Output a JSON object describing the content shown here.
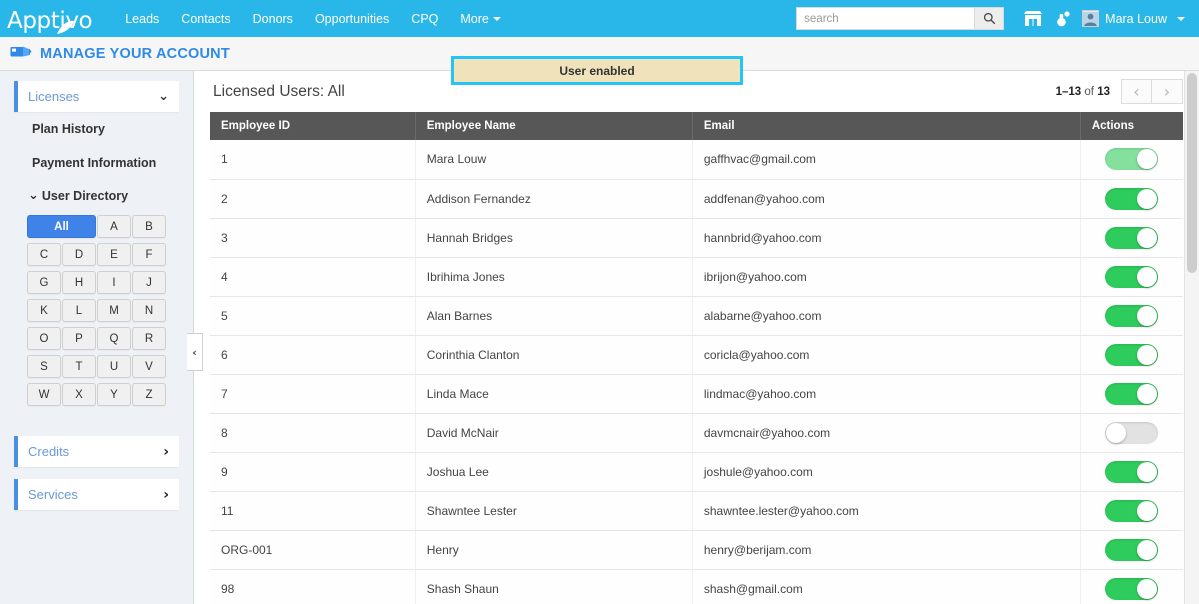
{
  "topnav": {
    "brand": "Apptivo",
    "brand_leaf_icon": "leaf-icon",
    "items": [
      {
        "label": "Leads",
        "icon": "none"
      },
      {
        "label": "Contacts",
        "icon": "none"
      },
      {
        "label": "Donors",
        "icon": "none"
      },
      {
        "label": "Opportunities",
        "icon": "none"
      },
      {
        "label": "CPQ",
        "icon": "none"
      },
      {
        "label": "More",
        "icon": "chevron-down-icon"
      }
    ],
    "search": {
      "value": "",
      "placeholder": "search",
      "button_icon": "search-icon"
    },
    "icons": [
      {
        "name": "storefront-icon"
      },
      {
        "name": "notification-bell-icon"
      }
    ],
    "user": {
      "name": "Mara Louw",
      "avatar_icon": "user-avatar-icon",
      "caret_icon": "chevron-down-icon"
    }
  },
  "subheader": {
    "icon": "account-card-icon",
    "title": "MANAGE YOUR ACCOUNT"
  },
  "banner": {
    "text": "User enabled",
    "background": "#f0e3bc",
    "border_color": "#22c5f5"
  },
  "sidebar": {
    "licenses": {
      "label": "Licenses",
      "chevron": "⌄",
      "expanded": true
    },
    "links": [
      {
        "label": "Plan History"
      },
      {
        "label": "Payment Information"
      }
    ],
    "user_directory": {
      "label": "User Directory",
      "chevron": "⌄"
    },
    "alpha_all": "All",
    "alpha_letters": [
      "A",
      "B",
      "C",
      "D",
      "E",
      "F",
      "G",
      "H",
      "I",
      "J",
      "K",
      "L",
      "M",
      "N",
      "O",
      "P",
      "Q",
      "R",
      "S",
      "T",
      "U",
      "V",
      "W",
      "X",
      "Y",
      "Z"
    ],
    "active_filter": "All",
    "panels": [
      {
        "label": "Credits",
        "chevron": "›"
      },
      {
        "label": "Services",
        "chevron": "›"
      }
    ],
    "collapse_icon": "‹"
  },
  "main": {
    "title": "Licensed Users: All",
    "pager": {
      "range": "1–13",
      "of": "of",
      "total": "13",
      "prev_icon": "‹",
      "next_icon": "›"
    },
    "table": {
      "columns": [
        "Employee ID",
        "Employee Name",
        "Email",
        "Actions"
      ],
      "rows": [
        {
          "id": "1",
          "name": "Mara Louw",
          "email": "gaffhvac@gmail.com",
          "toggle": "on-highlight"
        },
        {
          "id": "2",
          "name": "Addison Fernandez",
          "email": "addfenan@yahoo.com",
          "toggle": "on"
        },
        {
          "id": "3",
          "name": "Hannah Bridges",
          "email": "hannbrid@yahoo.com",
          "toggle": "on"
        },
        {
          "id": "4",
          "name": "Ibrihima Jones",
          "email": "ibrijon@yahoo.com",
          "toggle": "on"
        },
        {
          "id": "5",
          "name": "Alan Barnes",
          "email": "alabarne@yahoo.com",
          "toggle": "on"
        },
        {
          "id": "6",
          "name": "Corinthia Clanton",
          "email": "coricla@yahoo.com",
          "toggle": "on"
        },
        {
          "id": "7",
          "name": "Linda Mace",
          "email": "lindmac@yahoo.com",
          "toggle": "on"
        },
        {
          "id": "8",
          "name": "David McNair",
          "email": "davmcnair@yahoo.com",
          "toggle": "off"
        },
        {
          "id": "9",
          "name": "Joshua Lee",
          "email": "joshule@yahoo.com",
          "toggle": "on"
        },
        {
          "id": "11",
          "name": "Shawntee Lester",
          "email": "shawntee.lester@yahoo.com",
          "toggle": "on"
        },
        {
          "id": "ORG-001",
          "name": "Henry",
          "email": "henry@berijam.com",
          "toggle": "on"
        },
        {
          "id": "98",
          "name": "Shash Shaun",
          "email": "shash@gmail.com",
          "toggle": "on"
        }
      ]
    }
  },
  "colors": {
    "nav_blue": "#29b6e8",
    "accent_blue": "#2e8ae6",
    "header_gray": "#575757",
    "toggle_on": "#2ecc5c",
    "toggle_on_light": "#84e09c",
    "toggle_off": "#e2e2e2",
    "active_letter": "#3f82e8"
  }
}
